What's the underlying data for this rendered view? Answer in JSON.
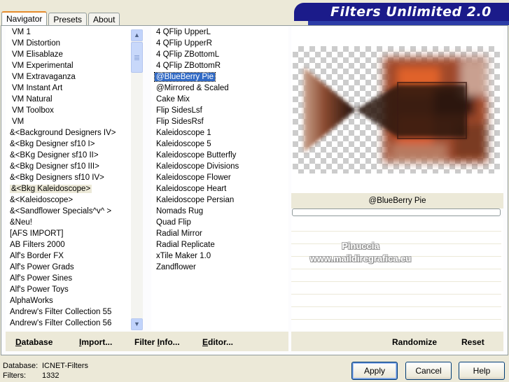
{
  "title": "Filters Unlimited 2.0",
  "tabs": [
    {
      "label": "Navigator"
    },
    {
      "label": "Presets"
    },
    {
      "label": "About"
    }
  ],
  "categories": [
    "VM 1",
    "VM Distortion",
    "VM Elisablaze",
    "VM Experimental",
    "VM Extravaganza",
    "VM Instant Art",
    "VM Natural",
    "VM Toolbox",
    "VM",
    "&<Background Designers IV>",
    "&<Bkg Designer sf10 I>",
    "&<BKg Designer sf10 II>",
    "&<Bkg Designer sf10 III>",
    "&<Bkg Designers sf10 IV>",
    "&<Bkg Kaleidoscope>",
    "&<Kaleidoscope>",
    "&<Sandflower Specials^v^ >",
    "&Neu!",
    "[AFS IMPORT]",
    "AB Filters 2000",
    "Alf's Border FX",
    "Alf's Power Grads",
    "Alf's Power Sines",
    "Alf's Power Toys",
    "AlphaWorks",
    "Andrew's Filter Collection 55",
    "Andrew's Filter Collection 56"
  ],
  "selected_category": "&<Bkg Kaleidoscope>",
  "filters": [
    "4 QFlip UpperL",
    "4 QFlip UpperR",
    "4 QFlip ZBottomL",
    "4 QFlip ZBottomR",
    "@BlueBerry Pie",
    "@Mirrored & Scaled",
    "Cake Mix",
    "Flip SidesLsf",
    "Flip SidesRsf",
    "Kaleidoscope 1",
    "Kaleidoscope 5",
    "Kaleidoscope Butterfly",
    "Kaleidoscope Divisions",
    "Kaleidoscope Flower",
    "Kaleidoscope Heart",
    "Kaleidoscope Persian",
    "Nomads Rug",
    "Quad Flip",
    "Radial Mirror",
    "Radial Replicate",
    "xTile Maker 1.0",
    "Zandflower"
  ],
  "selected_filter": "@BlueBerry Pie",
  "preview": {
    "filter_name": "@BlueBerry Pie",
    "watermark_line1": "Pinuccia",
    "watermark_line2": "www.maildiregrafica.eu",
    "colors": {
      "dark": "#2a1410",
      "brown": "#7a3a22",
      "orange": "#e0622a",
      "tan": "#c99a80"
    }
  },
  "links": {
    "database": {
      "label": "Database",
      "underline": "D",
      "rest": "atabase"
    },
    "import": {
      "label": "Import...",
      "underline": "I",
      "rest": "mport..."
    },
    "filter_info": {
      "label": "Filter Info...",
      "pre": "Filter ",
      "underline": "I",
      "rest": "nfo..."
    },
    "editor": {
      "label": "Editor...",
      "underline": "E",
      "rest": "ditor..."
    },
    "randomize": {
      "label": "Randomize"
    },
    "reset": {
      "label": "Reset"
    }
  },
  "status": {
    "database_label": "Database:",
    "database_value": "ICNET-Filters",
    "filters_label": "Filters:",
    "filters_value": "1332"
  },
  "buttons": {
    "apply": "Apply",
    "cancel": "Cancel",
    "help": "Help"
  },
  "accent_colors": {
    "banner": "#1b1b8a",
    "selection": "#316ac5",
    "tab_highlight": "#e68b2c"
  }
}
